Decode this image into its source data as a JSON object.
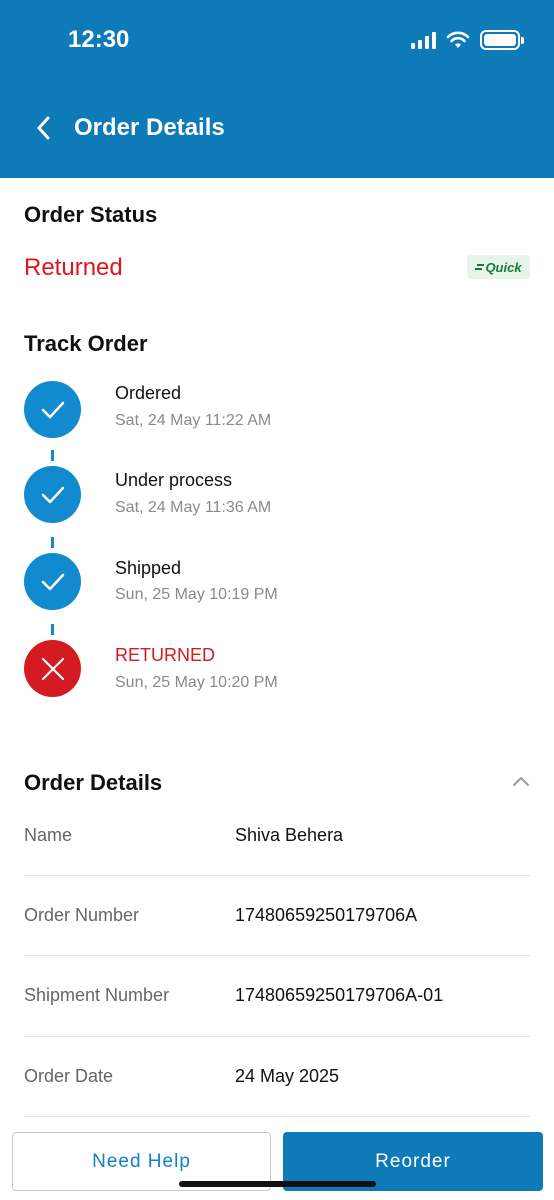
{
  "status_bar": {
    "time": "12:30"
  },
  "header": {
    "title": "Order Details"
  },
  "order_status": {
    "heading": "Order Status",
    "value": "Returned",
    "badge": "Quick",
    "colors": {
      "returned": "#e3151a",
      "primary": "#0f7ab8",
      "badge_bg": "#e6f4ea",
      "badge_text": "#177a3b"
    }
  },
  "track_order": {
    "heading": "Track Order",
    "steps": [
      {
        "label": "Ordered",
        "time": "Sat, 24 May 11:22 AM",
        "state": "done",
        "icon": "check-icon"
      },
      {
        "label": "Under process",
        "time": "Sat, 24 May 11:36 AM",
        "state": "done",
        "icon": "check-icon"
      },
      {
        "label": "Shipped",
        "time": "Sun, 25 May 10:19 PM",
        "state": "done",
        "icon": "check-icon"
      },
      {
        "label": "RETURNED",
        "time": "Sun, 25 May 10:20 PM",
        "state": "failed",
        "icon": "close-icon"
      }
    ]
  },
  "order_details": {
    "heading": "Order Details",
    "rows": [
      {
        "label": "Name",
        "value": "Shiva Behera"
      },
      {
        "label": "Order Number",
        "value": "17480659250179706A"
      },
      {
        "label": "Shipment Number",
        "value": "17480659250179706A-01"
      },
      {
        "label": "Order Date",
        "value": "24 May 2025"
      }
    ]
  },
  "actions": {
    "help": "Need Help",
    "reorder": "Reorder"
  }
}
